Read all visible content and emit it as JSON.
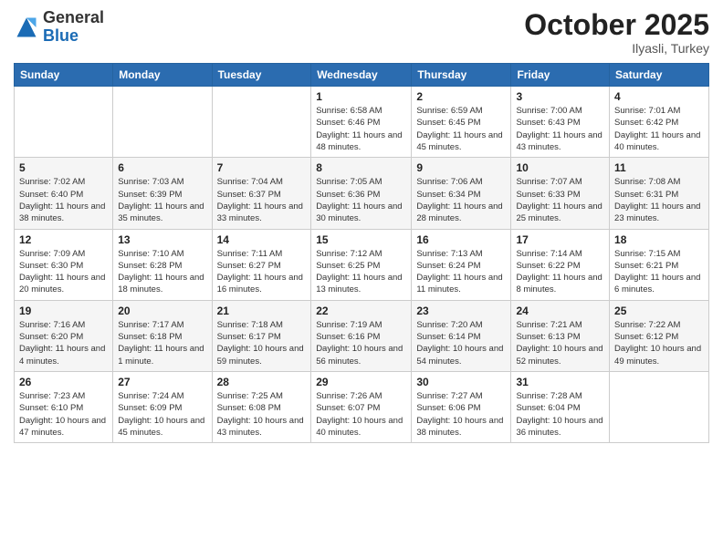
{
  "header": {
    "logo_general": "General",
    "logo_blue": "Blue",
    "month_title": "October 2025",
    "location": "Ilyasli, Turkey"
  },
  "days_of_week": [
    "Sunday",
    "Monday",
    "Tuesday",
    "Wednesday",
    "Thursday",
    "Friday",
    "Saturday"
  ],
  "weeks": [
    [
      {
        "day": "",
        "info": ""
      },
      {
        "day": "",
        "info": ""
      },
      {
        "day": "",
        "info": ""
      },
      {
        "day": "1",
        "info": "Sunrise: 6:58 AM\nSunset: 6:46 PM\nDaylight: 11 hours and 48 minutes."
      },
      {
        "day": "2",
        "info": "Sunrise: 6:59 AM\nSunset: 6:45 PM\nDaylight: 11 hours and 45 minutes."
      },
      {
        "day": "3",
        "info": "Sunrise: 7:00 AM\nSunset: 6:43 PM\nDaylight: 11 hours and 43 minutes."
      },
      {
        "day": "4",
        "info": "Sunrise: 7:01 AM\nSunset: 6:42 PM\nDaylight: 11 hours and 40 minutes."
      }
    ],
    [
      {
        "day": "5",
        "info": "Sunrise: 7:02 AM\nSunset: 6:40 PM\nDaylight: 11 hours and 38 minutes."
      },
      {
        "day": "6",
        "info": "Sunrise: 7:03 AM\nSunset: 6:39 PM\nDaylight: 11 hours and 35 minutes."
      },
      {
        "day": "7",
        "info": "Sunrise: 7:04 AM\nSunset: 6:37 PM\nDaylight: 11 hours and 33 minutes."
      },
      {
        "day": "8",
        "info": "Sunrise: 7:05 AM\nSunset: 6:36 PM\nDaylight: 11 hours and 30 minutes."
      },
      {
        "day": "9",
        "info": "Sunrise: 7:06 AM\nSunset: 6:34 PM\nDaylight: 11 hours and 28 minutes."
      },
      {
        "day": "10",
        "info": "Sunrise: 7:07 AM\nSunset: 6:33 PM\nDaylight: 11 hours and 25 minutes."
      },
      {
        "day": "11",
        "info": "Sunrise: 7:08 AM\nSunset: 6:31 PM\nDaylight: 11 hours and 23 minutes."
      }
    ],
    [
      {
        "day": "12",
        "info": "Sunrise: 7:09 AM\nSunset: 6:30 PM\nDaylight: 11 hours and 20 minutes."
      },
      {
        "day": "13",
        "info": "Sunrise: 7:10 AM\nSunset: 6:28 PM\nDaylight: 11 hours and 18 minutes."
      },
      {
        "day": "14",
        "info": "Sunrise: 7:11 AM\nSunset: 6:27 PM\nDaylight: 11 hours and 16 minutes."
      },
      {
        "day": "15",
        "info": "Sunrise: 7:12 AM\nSunset: 6:25 PM\nDaylight: 11 hours and 13 minutes."
      },
      {
        "day": "16",
        "info": "Sunrise: 7:13 AM\nSunset: 6:24 PM\nDaylight: 11 hours and 11 minutes."
      },
      {
        "day": "17",
        "info": "Sunrise: 7:14 AM\nSunset: 6:22 PM\nDaylight: 11 hours and 8 minutes."
      },
      {
        "day": "18",
        "info": "Sunrise: 7:15 AM\nSunset: 6:21 PM\nDaylight: 11 hours and 6 minutes."
      }
    ],
    [
      {
        "day": "19",
        "info": "Sunrise: 7:16 AM\nSunset: 6:20 PM\nDaylight: 11 hours and 4 minutes."
      },
      {
        "day": "20",
        "info": "Sunrise: 7:17 AM\nSunset: 6:18 PM\nDaylight: 11 hours and 1 minute."
      },
      {
        "day": "21",
        "info": "Sunrise: 7:18 AM\nSunset: 6:17 PM\nDaylight: 10 hours and 59 minutes."
      },
      {
        "day": "22",
        "info": "Sunrise: 7:19 AM\nSunset: 6:16 PM\nDaylight: 10 hours and 56 minutes."
      },
      {
        "day": "23",
        "info": "Sunrise: 7:20 AM\nSunset: 6:14 PM\nDaylight: 10 hours and 54 minutes."
      },
      {
        "day": "24",
        "info": "Sunrise: 7:21 AM\nSunset: 6:13 PM\nDaylight: 10 hours and 52 minutes."
      },
      {
        "day": "25",
        "info": "Sunrise: 7:22 AM\nSunset: 6:12 PM\nDaylight: 10 hours and 49 minutes."
      }
    ],
    [
      {
        "day": "26",
        "info": "Sunrise: 7:23 AM\nSunset: 6:10 PM\nDaylight: 10 hours and 47 minutes."
      },
      {
        "day": "27",
        "info": "Sunrise: 7:24 AM\nSunset: 6:09 PM\nDaylight: 10 hours and 45 minutes."
      },
      {
        "day": "28",
        "info": "Sunrise: 7:25 AM\nSunset: 6:08 PM\nDaylight: 10 hours and 43 minutes."
      },
      {
        "day": "29",
        "info": "Sunrise: 7:26 AM\nSunset: 6:07 PM\nDaylight: 10 hours and 40 minutes."
      },
      {
        "day": "30",
        "info": "Sunrise: 7:27 AM\nSunset: 6:06 PM\nDaylight: 10 hours and 38 minutes."
      },
      {
        "day": "31",
        "info": "Sunrise: 7:28 AM\nSunset: 6:04 PM\nDaylight: 10 hours and 36 minutes."
      },
      {
        "day": "",
        "info": ""
      }
    ]
  ]
}
